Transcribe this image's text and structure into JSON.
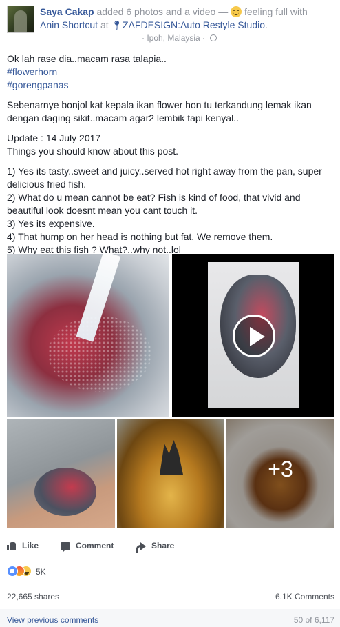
{
  "header": {
    "author": "Saya Cakap",
    "added_text": " added 6 photos and a video — ",
    "feeling_text": " feeling full with",
    "tagged": "Anin Shortcut",
    "at_text": " at ",
    "place": "ZAFDESIGN:Auto Restyle Studio",
    "place_suffix": ".",
    "location": "· Ipoh, Malaysia · "
  },
  "post": {
    "line1": "Ok lah rase dia..macam rasa talapia..",
    "hashtag1": "#flowerhorn",
    "hashtag2": "#gorengpanas",
    "para2": "Sebenarnye bonjol kat kepala ikan flower hon tu terkandung lemak ikan dengan daging sikit..macam agar2 lembik tapi kenyal..",
    "update": "Update : 14 July 2017",
    "intro": "Things you should know about this post.",
    "items": [
      "1) Yes its tasty..sweet and juicy..served hot right away from the pan, super delicious fried fish.",
      "2) What do u mean cannot be eat? Fish is kind of food, that vivid and beautiful look doesnt mean you cant touch it.",
      "3) Yes its expensive.",
      "4) That hump on her head is nothing but fat. We remove them.",
      "5) Why eat this fish ? What?..why not..lol"
    ]
  },
  "media": {
    "more_count": "+3"
  },
  "actions": {
    "like": "Like",
    "comment": "Comment",
    "share": "Share"
  },
  "reactions": {
    "count": "5K"
  },
  "stats": {
    "shares": "22,665 shares",
    "comments": "6.1K Comments"
  },
  "comments": {
    "view_previous": "View previous comments",
    "pager": "50 of 6,117"
  },
  "colors": {
    "link": "#365899",
    "meta": "#90949c",
    "text": "#1d2129"
  }
}
